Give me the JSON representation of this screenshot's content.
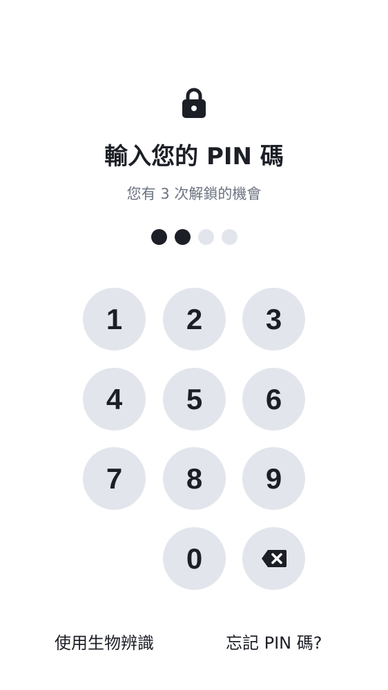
{
  "header": {
    "lock_icon": "lock-icon",
    "title": "輸入您的 PIN 碼",
    "subtitle": "您有 3 次解鎖的機會"
  },
  "pin": {
    "length": 4,
    "entered": 2
  },
  "keypad": {
    "keys": [
      "1",
      "2",
      "3",
      "4",
      "5",
      "6",
      "7",
      "8",
      "9",
      "0"
    ],
    "backspace_icon": "backspace-icon"
  },
  "footer": {
    "biometric_label": "使用生物辨識",
    "forgot_label": "忘記 PIN 碼?"
  },
  "colors": {
    "background": "#ffffff",
    "text": "#1c1f26",
    "muted": "#6b7280",
    "key_bg": "#e2e6ec",
    "dot_filled": "#1c1f26",
    "dot_empty": "#e2e6ec"
  }
}
